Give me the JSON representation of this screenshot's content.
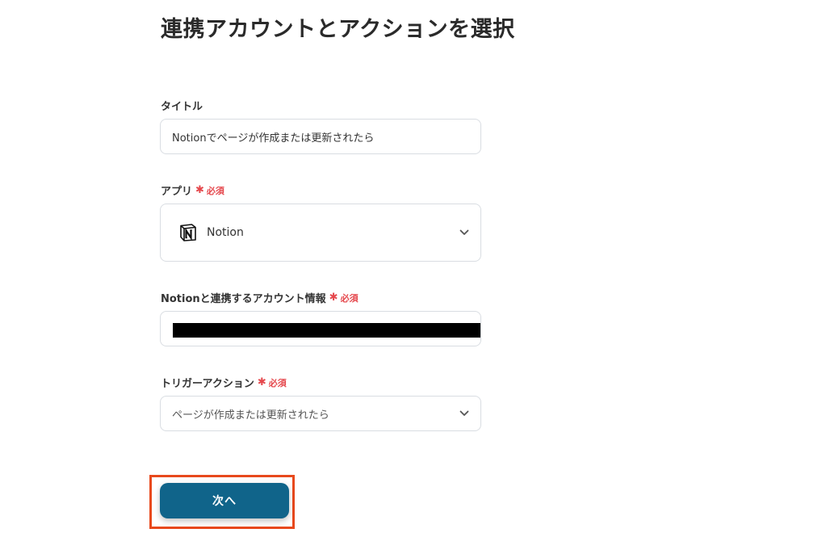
{
  "page": {
    "title": "連携アカウントとアクションを選択"
  },
  "fields": {
    "title_field": {
      "label": "タイトル",
      "value": "Notionでページが作成または更新されたら"
    },
    "app_field": {
      "label": "アプリ",
      "required_label": "必須",
      "value": "Notion",
      "icon": "notion-logo-icon"
    },
    "account_field": {
      "label": "Notionと連携するアカウント情報",
      "required_label": "必須",
      "value_redacted": true
    },
    "trigger_field": {
      "label": "トリガーアクション",
      "required_label": "必須",
      "value": "ページが作成または更新されたら"
    }
  },
  "actions": {
    "next_label": "次へ"
  },
  "colors": {
    "primary_button": "#10648a",
    "required": "#e5484d",
    "highlight": "#e8491d"
  }
}
